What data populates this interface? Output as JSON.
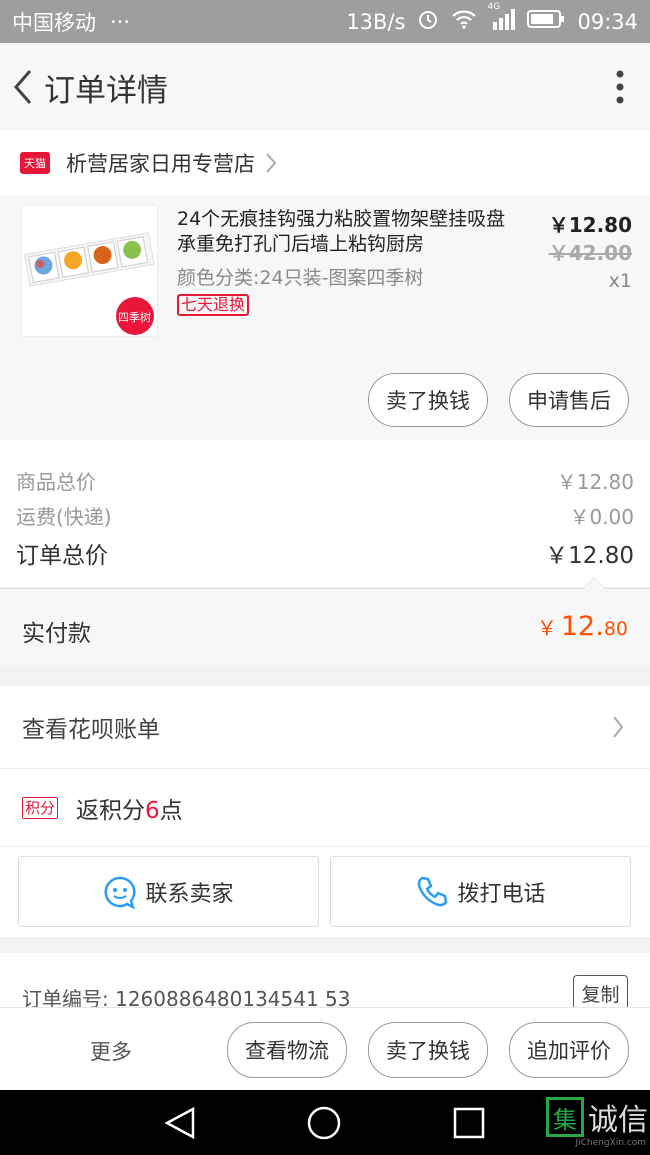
{
  "status_bar": {
    "carrier": "中国移动",
    "dots": "···",
    "speed": "13B/s",
    "network": "4G",
    "time": "09:34"
  },
  "nav": {
    "title": "订单详情"
  },
  "shop": {
    "badge": "天猫",
    "name": "析营居家日用专营店"
  },
  "item": {
    "title": "24个无痕挂钩强力粘胶置物架壁挂吸盘承重免打孔门后墙上粘钩厨房",
    "sku": "颜色分类:24只装-图案四季树",
    "tag": "七天退换",
    "price": "￥12.80",
    "original_price": "￥42.00",
    "quantity": "x1",
    "thumb_label": "四季树",
    "actions": [
      "卖了换钱",
      "申请售后"
    ]
  },
  "summary": {
    "goods_label": "商品总价",
    "goods_value": "￥12.80",
    "shipping_label": "运费(快递)",
    "shipping_value": "￥0.00",
    "total_label": "订单总价",
    "total_value": "￥12.80",
    "paid_label": "实付款",
    "paid_currency": "￥",
    "paid_int": "12.",
    "paid_dec": "80"
  },
  "huabei": {
    "label": "查看花呗账单"
  },
  "points": {
    "badge": "积分",
    "prefix": "返积分",
    "count": "6",
    "suffix": "点"
  },
  "contact": {
    "seller": "联系卖家",
    "phone": "拨打电话"
  },
  "order": {
    "number_text": "订单编号: 1260886480134541 53",
    "copy": "复制"
  },
  "bottom_bar": {
    "more": "更多",
    "buttons": [
      "查看物流",
      "卖了换钱",
      "追加评价"
    ]
  },
  "watermark": {
    "box_char": "集",
    "text": "诚信",
    "sub": "JiChengXin.com"
  },
  "colors": {
    "accent": "#ff5000",
    "tmall_red": "#e8173a",
    "status_bar": "#9e9e9e"
  }
}
